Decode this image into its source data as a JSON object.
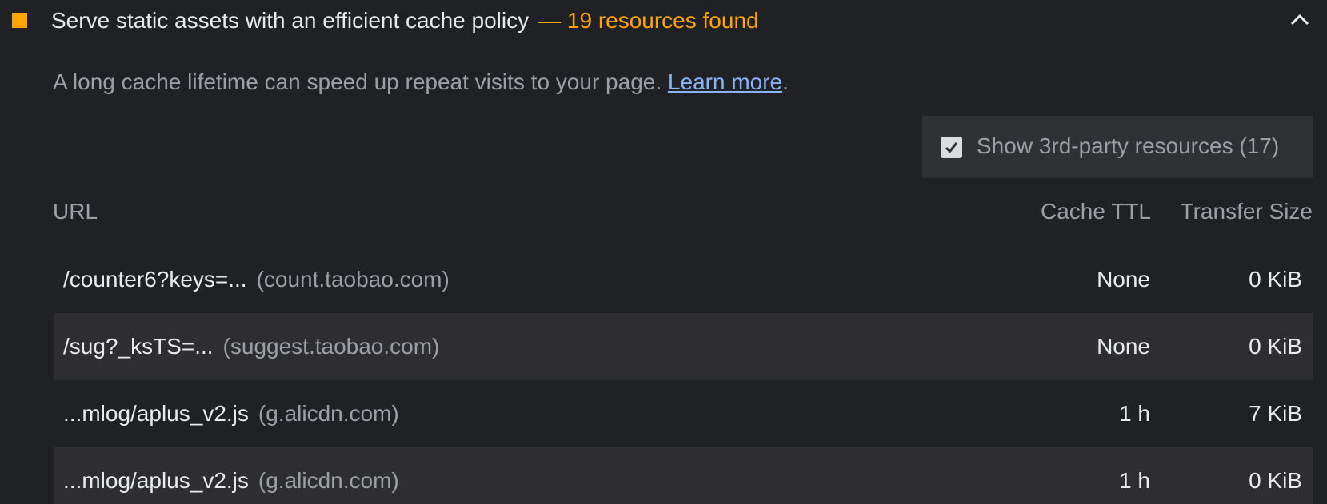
{
  "audit": {
    "title": "Serve static assets with an efficient cache policy",
    "display_value": "— 19 resources found",
    "status_color": "#ffa400",
    "expand_icon": "chevron-up-icon",
    "description": "A long cache lifetime can speed up repeat visits to your page.",
    "learn_more": "Learn more",
    "description_end": "."
  },
  "filter": {
    "checked": true,
    "label": "Show 3rd-party resources (17)"
  },
  "table": {
    "headers": {
      "url": "URL",
      "cache_ttl": "Cache TTL",
      "transfer_size": "Transfer Size"
    },
    "rows": [
      {
        "path": "/counter6?keys=...",
        "host": "(count.taobao.com)",
        "cache_ttl": "None",
        "transfer_size": "0 KiB"
      },
      {
        "path": "/sug?_ksTS=...",
        "host": "(suggest.taobao.com)",
        "cache_ttl": "None",
        "transfer_size": "0 KiB"
      },
      {
        "path": "...mlog/aplus_v2.js",
        "host": "(g.alicdn.com)",
        "cache_ttl": "1 h",
        "transfer_size": "7 KiB"
      },
      {
        "path": "...mlog/aplus_v2.js",
        "host": "(g.alicdn.com)",
        "cache_ttl": "1 h",
        "transfer_size": "0 KiB"
      }
    ]
  },
  "colors": {
    "background": "#202124",
    "warning": "#ffa400",
    "link": "#8ab4f8",
    "row_alt": "#2e2e30",
    "text": "#e8eaed",
    "muted": "#9aa0a6"
  }
}
